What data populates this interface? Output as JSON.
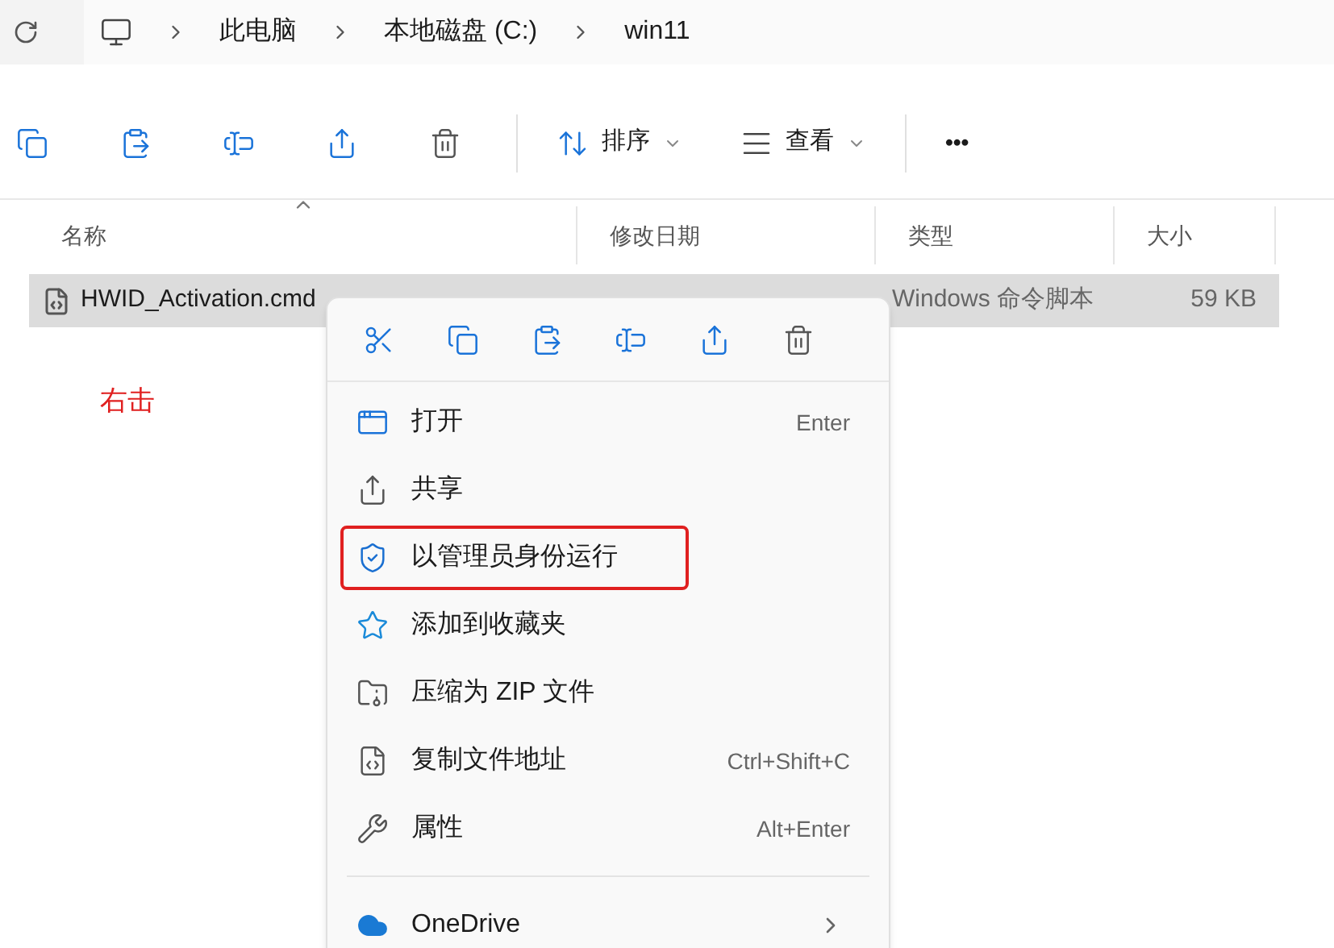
{
  "breadcrumb": [
    "此电脑",
    "本地磁盘 (C:)",
    "win11"
  ],
  "toolbar": {
    "sort": "排序",
    "view": "查看",
    "more": "•••"
  },
  "columns": [
    {
      "label": "名称",
      "sorted": true
    },
    {
      "label": "修改日期",
      "sorted": false
    },
    {
      "label": "类型",
      "sorted": false
    },
    {
      "label": "大小",
      "sorted": false
    }
  ],
  "files": [
    {
      "name": "HWID_Activation.cmd",
      "type": "Windows 命令脚本",
      "size": "59 KB",
      "selected": true
    }
  ],
  "annotation": "右击",
  "context_menu": {
    "items": [
      {
        "kind": "open",
        "label": "打开",
        "shortcut": "Enter",
        "highlighted": false
      },
      {
        "kind": "share",
        "label": "共享",
        "highlighted": false
      },
      {
        "kind": "admin",
        "label": "以管理员身份运行",
        "highlighted": true
      },
      {
        "kind": "favorite",
        "label": "添加到收藏夹",
        "highlighted": false
      },
      {
        "kind": "zip",
        "label": "压缩为 ZIP 文件",
        "highlighted": false
      },
      {
        "kind": "path",
        "label": "复制文件地址",
        "shortcut": "Ctrl+Shift+C",
        "highlighted": false
      },
      {
        "kind": "properties",
        "label": "属性",
        "shortcut": "Alt+Enter",
        "highlighted": false
      },
      {
        "kind": "onedrive",
        "label": "OneDrive",
        "submenu": true,
        "highlighted": false
      }
    ]
  }
}
